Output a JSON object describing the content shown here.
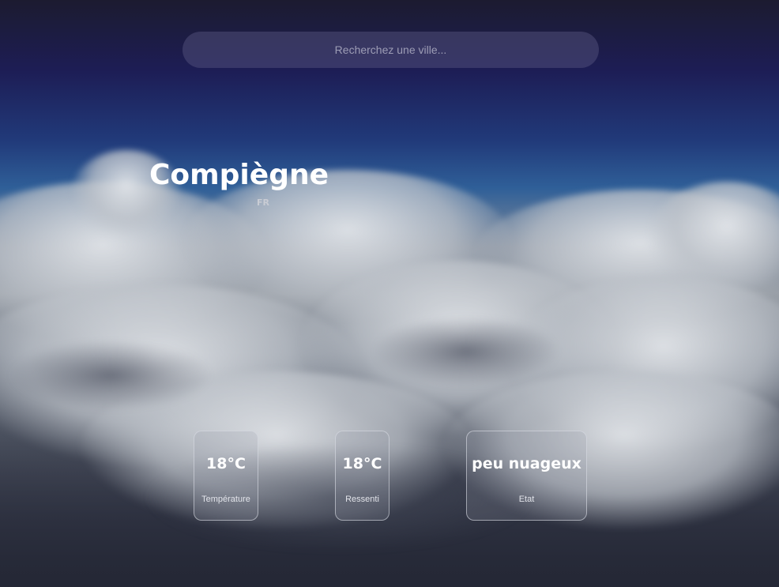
{
  "search": {
    "placeholder": "Recherchez une ville...",
    "value": ""
  },
  "location": {
    "city": "Compiègne",
    "country": "FR"
  },
  "cards": [
    {
      "value": "18°C",
      "label": "Température"
    },
    {
      "value": "18°C",
      "label": "Ressenti"
    },
    {
      "value": "peu nuageux",
      "label": "Etat"
    }
  ],
  "colors": {
    "text": "#ffffff",
    "card_border": "#dce0e8",
    "search_bg": "#5a5882"
  }
}
